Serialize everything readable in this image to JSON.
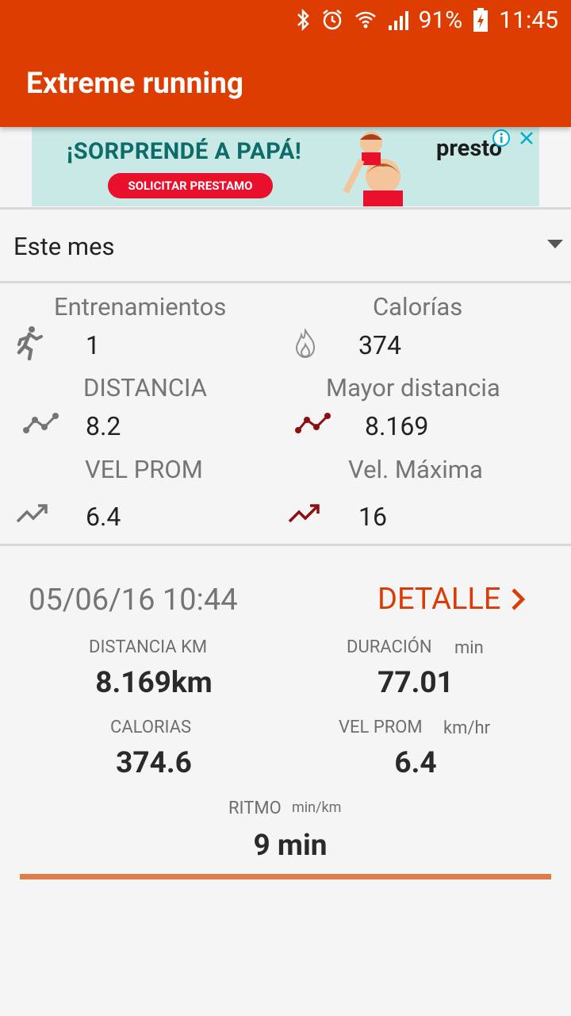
{
  "status_bar": {
    "battery": "91%",
    "time": "11:45"
  },
  "app": {
    "title": "Extreme running"
  },
  "ad": {
    "headline": "¡SORPRENDÉ A PAPÁ!",
    "button": "SOLICITAR PRESTAMO",
    "brand": "presto"
  },
  "filter": {
    "selected": "Este mes"
  },
  "stats": {
    "trainings": {
      "label": "Entrenamientos",
      "value": "1"
    },
    "calories": {
      "label": "Calorías",
      "value": "374"
    },
    "distance": {
      "label": "DISTANCIA",
      "value": "8.2"
    },
    "max_distance": {
      "label": "Mayor distancia",
      "value": "8.169"
    },
    "avg_speed": {
      "label": "VEL PROM",
      "value": "6.4"
    },
    "max_speed": {
      "label": "Vel. Máxima",
      "value": "16"
    }
  },
  "last_run": {
    "date": "05/06/16 10:44",
    "detail_label": "DETALLE",
    "distance_label": "DISTANCIA KM",
    "distance_value": "8.169km",
    "duration_label": "DURACIÓN",
    "duration_unit": "min",
    "duration_value": "77.01",
    "calories_label": "CALORIAS",
    "calories_value": "374.6",
    "speed_label": "VEL PROM",
    "speed_unit": "km/hr",
    "speed_value": "6.4",
    "pace_label": "RITMO",
    "pace_unit": "min/km",
    "pace_value": "9 min"
  },
  "colors": {
    "appbar": "#dd3d00",
    "accent": "#d93c06",
    "icon_dark_red": "#8b1111",
    "icon_gray": "#757575"
  }
}
